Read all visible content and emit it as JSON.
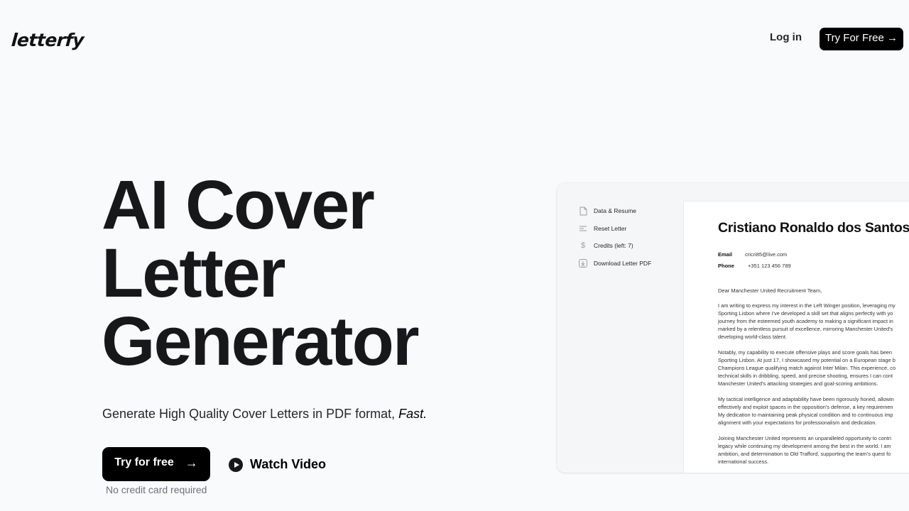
{
  "nav": {
    "logo": "letterfy",
    "login_label": "Log in",
    "cta_label": "Try For Free →"
  },
  "hero": {
    "headline": [
      "AI Cover",
      "Letter",
      "Generator"
    ],
    "subtitle_main": "Generate High Quality Cover Letters in PDF format, ",
    "subtitle_emphasis": "Fast.",
    "cta_label": "Try for free",
    "cta_arrow": "→",
    "cta_note": "No credit card required",
    "watch_label": "Watch Video"
  },
  "preview": {
    "sidebar": [
      {
        "icon": "document-icon",
        "label": "Data & Resume"
      },
      {
        "icon": "lines-icon",
        "label": "Reset Letter"
      },
      {
        "icon": "dollar-icon",
        "label": "Credits (left: 7)"
      },
      {
        "icon": "download-icon",
        "label": "Download Letter PDF"
      }
    ],
    "letter": {
      "name": "Cristiano Ronaldo dos Santos",
      "email_label": "Email",
      "email": "cricri85@live.com",
      "phone_label": "Phone",
      "phone": "+351 123 456 789",
      "greeting": "Dear Manchester United Recruitment Team,",
      "paragraphs": [
        "I am writing to express my interest in the Left Winger position, leveraging my\nSporting Lisbon where I've developed a skill set that aligns perfectly with yo\njourney from the esteemed youth academy to making a significant impact in\nmarked by a relentless pursuit of excellence, mirroring Manchester United's\ndeveloping world-class talent.",
        "Notably, my capability to execute offensive plays and score goals has been\nSporting Lisbon. At just 17, I showcased my potential on a European stage b\nChampions League qualifying match against Inter Milan. This experience, co\ntechnical skills in dribbling, speed, and precise shooting, ensures I can cont\nManchester United's attacking strategies and goal-scoring ambitions.",
        "My tactical intelligence and adaptability have been rigorously honed, allowin\neffectively and exploit spaces in the opposition's defense, a key requiremen\nMy dedication to maintaining peak physical condition and to continuous imp\nalignment with your expectations for professionalism and dedication.",
        "Joining Manchester United represents an unparalleled opportunity to contri\nlegacy while continuing my development among the best in the world. I am\nambition, and determination to Old Trafford, supporting the team's quest fo\ninternational success."
      ]
    }
  }
}
